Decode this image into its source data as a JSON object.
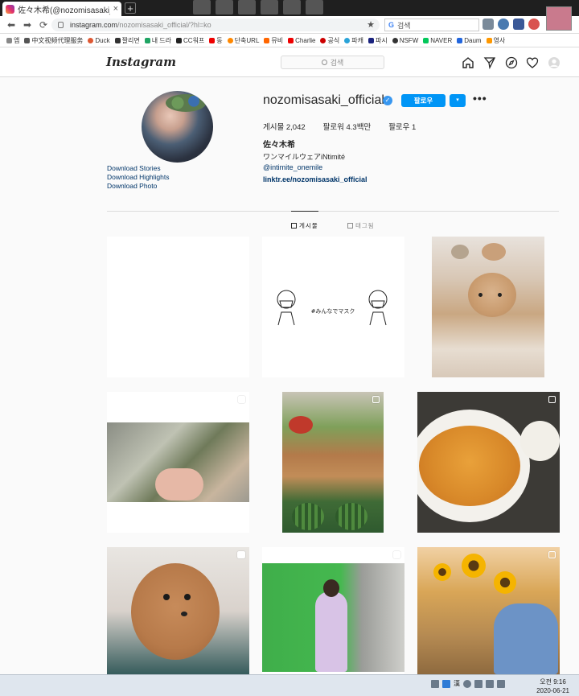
{
  "browser": {
    "tab_title": "佐々木希(@nozomisasaki_officia",
    "tab_close": "×",
    "new_tab": "+",
    "url_host": "instagram.com",
    "url_path": "/nozomisasaki_official/?hl=ko",
    "search_placeholder": "검색",
    "bookmarks": [
      "앱",
      "中文视频代理服务",
      "Duck",
      "짤리면",
      "내 드라",
      "CC워프",
      "동",
      "단축URL",
      "뮤비",
      "Charlie",
      "공식",
      "파캐",
      "파시",
      "NSFW",
      "NAVER",
      "Daum",
      "영사"
    ]
  },
  "instagram": {
    "logo": "Instagram",
    "search_placeholder": "검색"
  },
  "profile": {
    "username": "nozomisasaki_official",
    "follow_label": "팔로우",
    "dropdown_label": "▾",
    "more_label": "•••",
    "posts_label": "게시물 2,042",
    "followers_label": "팔로워 4.3백만",
    "following_label": "팔로우 1",
    "full_name": "佐々木希",
    "bio_line1": "ワンマイルウェアiNtimité",
    "bio_line2": "@intimite_onemile",
    "bio_link": "linktr.ee/nozomisasaki_official",
    "download_links": [
      "Download Stories",
      "Download Highlights",
      "Download Photo"
    ]
  },
  "tabs": {
    "posts": "게시물",
    "tagged": "태그됨"
  },
  "posts": [
    {
      "id": "blank"
    },
    {
      "id": "mask-illustration",
      "text": "#みんなでマスク"
    },
    {
      "id": "dogs"
    },
    {
      "id": "vegetables-pot",
      "multi": true
    },
    {
      "id": "vegetable-box",
      "multi": true
    },
    {
      "id": "curry-bowl",
      "multi": true
    },
    {
      "id": "poodle",
      "video": true
    },
    {
      "id": "green-screen",
      "multi": true
    },
    {
      "id": "sunflowers"
    }
  ],
  "taskbar": {
    "ime_label": "漢",
    "time": "오전 9:16",
    "date": "2020-06-21"
  }
}
